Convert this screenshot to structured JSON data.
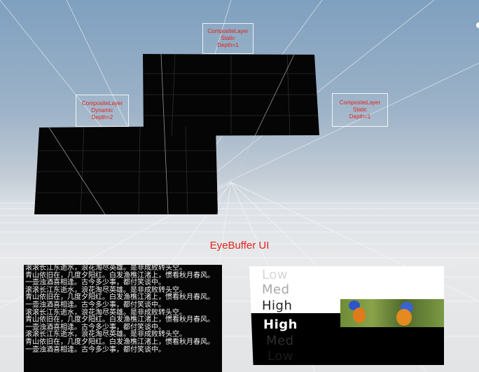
{
  "scene": {
    "layers": [
      {
        "label_lines": [
          "CompositeLayer",
          "Static",
          "Depth=1"
        ]
      },
      {
        "label_lines": [
          "CompositeLayer",
          "Dynamic",
          "Depth=2"
        ]
      },
      {
        "label_lines": [
          "CompositeLayer",
          "Static",
          "Depth=1"
        ]
      }
    ],
    "eyebuffer_title": "EyeBuffer UI",
    "poem_lines": [
      "滚滚长江东逝水，浪花淘尽英雄。是非成败转头空。",
      "青山依旧在，几度夕阳红。白发渔樵江渚上，惯看秋月春风。",
      "一壶浊酒喜相逢。古今多少事，都付笑谈中。",
      "滚滚长江东逝水，浪花淘尽英雄。是非成败转头空。",
      "青山依旧在，几度夕阳红。白发渔樵江渚上，惯看秋月春风。",
      "一壶浊酒喜相逢。古今多少事，都付笑谈中。",
      "滚滚长江东逝水，浪花淘尽英雄。是非成败转头空。",
      "青山依旧在，几度夕阳红。白发渔樵江渚上，惯看秋月春风。",
      "一壶浊酒喜相逢。古今多少事，都付笑谈中。",
      "滚滚长江东逝水，浪花淘尽英雄。是非成败转头空。",
      "青山依旧在，几度夕阳红。白发渔樵江渚上，惯看秋月春风。",
      "一壶浊酒喜相逢。古今多少事，都付笑谈中。"
    ],
    "quality": {
      "top_labels": [
        "Low",
        "Med",
        "High"
      ],
      "bottom_labels": [
        "High",
        "Med",
        "Low"
      ]
    },
    "colors": {
      "label_red": "#e0241b",
      "panel_black": "#000000"
    }
  }
}
